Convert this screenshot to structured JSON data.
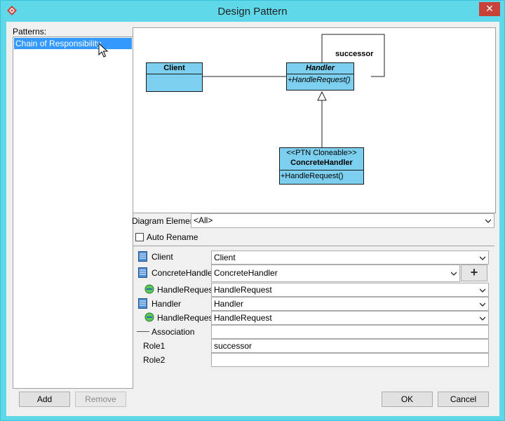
{
  "window": {
    "title": "Design Pattern",
    "close_glyph": "✕"
  },
  "patterns": {
    "label": "Patterns:",
    "items": [
      "Chain of Responsibility"
    ],
    "selected": "Chain of Responsibility"
  },
  "diagram": {
    "client": {
      "name": "Client"
    },
    "handler": {
      "name": "Handler",
      "operation": "+HandleRequest()",
      "self_association_role": "successor"
    },
    "concrete_handler": {
      "stereotype": "<<PTN Cloneable>>",
      "name": "ConcreteHandler",
      "operation": "+HandleRequest()"
    }
  },
  "diagram_element": {
    "label": "Diagram Element",
    "value": "<All>"
  },
  "auto_rename": {
    "label": "Auto Rename",
    "checked": false
  },
  "properties": [
    {
      "label": "Client",
      "kind": "class",
      "value": "Client"
    },
    {
      "label": "ConcreteHandler",
      "kind": "class",
      "value": "ConcreteHandler"
    },
    {
      "label": "HandleRequest",
      "kind": "operation",
      "value": "HandleRequest"
    },
    {
      "label": "Handler",
      "kind": "class",
      "value": "Handler"
    },
    {
      "label": "HandleRequest",
      "kind": "operation",
      "value": "HandleRequest"
    },
    {
      "label": "Association",
      "kind": "association",
      "value": ""
    },
    {
      "label": "Role1",
      "kind": "role",
      "value": "successor"
    },
    {
      "label": "Role2",
      "kind": "role",
      "value": ""
    }
  ],
  "add_button": {
    "glyph": "+"
  },
  "buttons": {
    "add": "Add",
    "remove": "Remove",
    "ok": "OK",
    "cancel": "Cancel"
  }
}
